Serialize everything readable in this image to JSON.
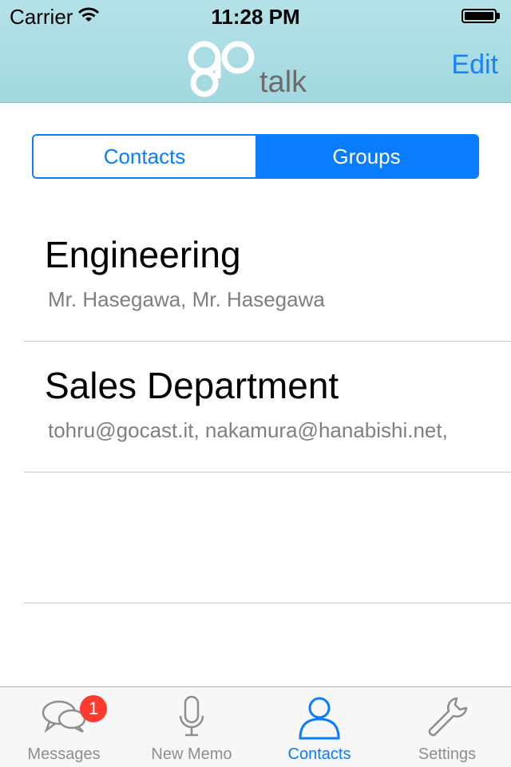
{
  "status_bar": {
    "carrier": "Carrier",
    "time": "11:28 PM"
  },
  "header": {
    "logo_go": "go",
    "logo_talk": "talk",
    "edit_label": "Edit"
  },
  "segmented": {
    "contacts_label": "Contacts",
    "groups_label": "Groups",
    "selected": "Groups"
  },
  "groups": [
    {
      "name": "Engineering",
      "members": "Mr. Hasegawa, Mr. Hasegawa"
    },
    {
      "name": "Sales Department",
      "members": "tohru@gocast.it, nakamura@hanabishi.net,"
    }
  ],
  "tabbar": {
    "items": [
      {
        "label": "Messages",
        "icon": "chat-bubbles-icon",
        "badge": "1"
      },
      {
        "label": "New Memo",
        "icon": "microphone-icon"
      },
      {
        "label": "Contacts",
        "icon": "person-icon",
        "active": true
      },
      {
        "label": "Settings",
        "icon": "wrench-icon"
      }
    ]
  },
  "colors": {
    "accent": "#0a7cff",
    "header_bg": "#aadce2",
    "badge": "#ff3b30"
  }
}
